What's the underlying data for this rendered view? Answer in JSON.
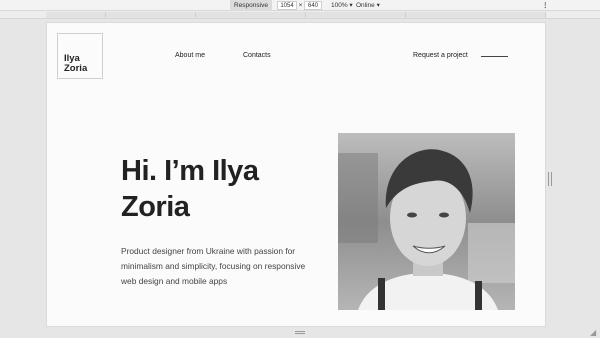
{
  "devtools": {
    "device": "Responsive ▾",
    "width": "1054",
    "times": "×",
    "height": "640",
    "zoom": "100% ▾",
    "network": "Online ▾",
    "more": "⋮"
  },
  "site": {
    "logo": "Ilya\nZoria",
    "nav": {
      "about": "About me",
      "contacts": "Contacts",
      "request": "Request a project"
    },
    "hero": {
      "title": "Hi. I’m Ilya Zoria",
      "description": "Product designer from Ukraine with passion for minimalism and simplicity, focusing on responsive web design and mobile apps"
    }
  },
  "colors": {
    "page_background": "#fbfbfc",
    "text": "#222222",
    "devtools_background": "#e6e6e6"
  }
}
